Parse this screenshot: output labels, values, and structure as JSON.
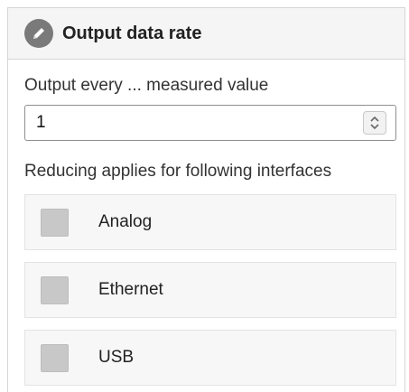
{
  "panel": {
    "title": "Output data rate",
    "icon": "pencil-icon"
  },
  "output_every": {
    "label": "Output every ... measured value",
    "value": "1"
  },
  "reducing": {
    "label": "Reducing applies for following interfaces",
    "interfaces": [
      {
        "label": "Analog",
        "checked": false
      },
      {
        "label": "Ethernet",
        "checked": false
      },
      {
        "label": "USB",
        "checked": false
      }
    ]
  }
}
